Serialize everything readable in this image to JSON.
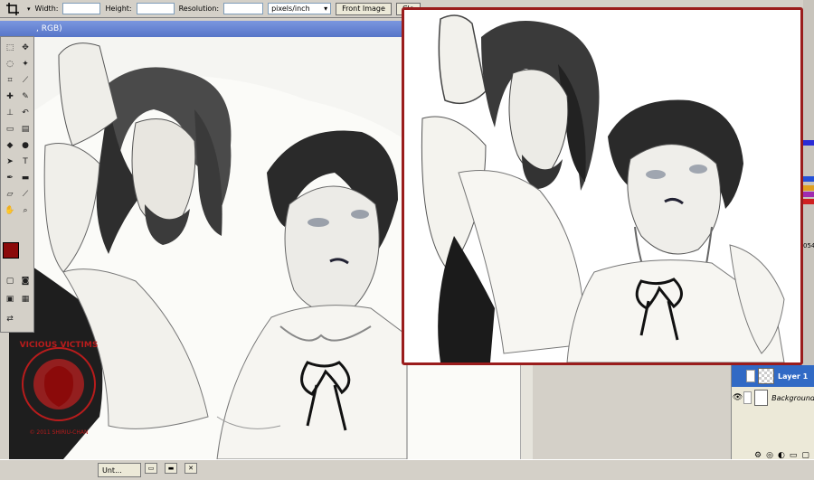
{
  "options_bar": {
    "tool_icon": "crop-icon",
    "width_label": "Width:",
    "width_value": "",
    "height_label": "Height:",
    "height_value": "",
    "resolution_label": "Resolution:",
    "resolution_value": "",
    "units_value": "pixels/inch",
    "front_image_label": "Front Image",
    "clear_label": "Cle"
  },
  "document": {
    "title_fragment": ", RGB)"
  },
  "toolbox": {
    "foreground_color": "#8b0a0a",
    "background_color": "#ffffff"
  },
  "watermark": {
    "top_text": "VICIOUS VICTIMS",
    "bottom_text": "© 2011 SHIRIU-CHAN"
  },
  "preview": {
    "border_color": "#9a1c1c"
  },
  "layers_panel": {
    "rows": [
      {
        "name": "Layer 1",
        "active": true
      },
      {
        "name": "Background",
        "active": false
      }
    ],
    "opacity_fragment": "054"
  },
  "taskbar": {
    "doc_task_label": "Unt..."
  }
}
